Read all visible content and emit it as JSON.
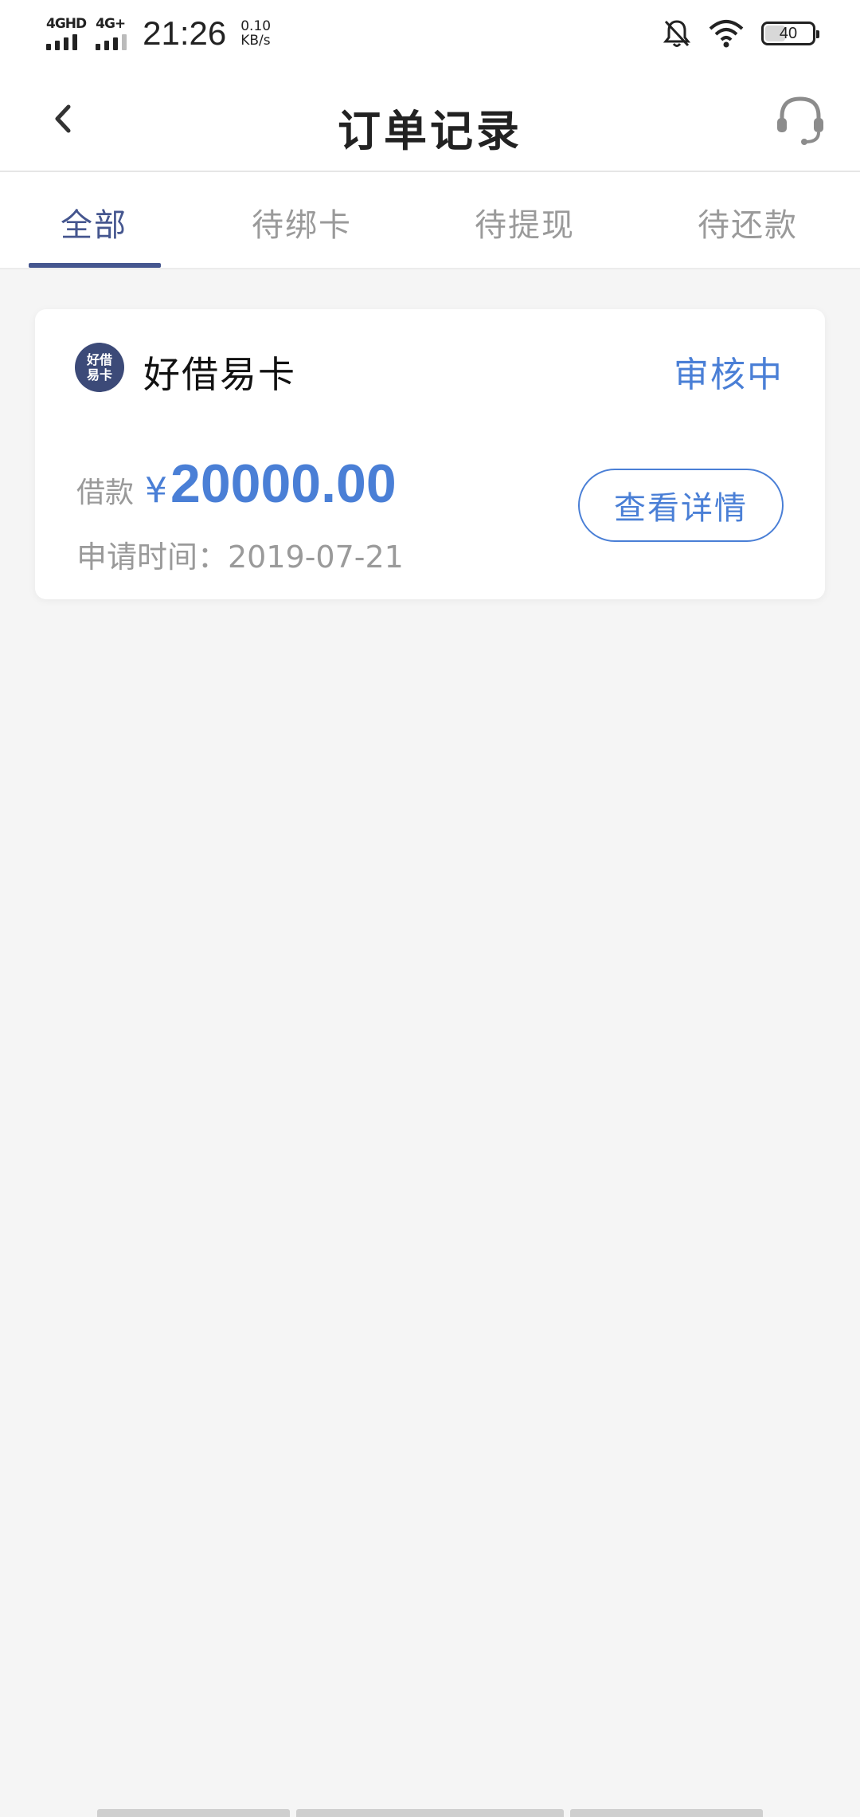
{
  "status_bar": {
    "network_1": "4GHD",
    "network_2": "4G+",
    "time": "21:26",
    "speed_value": "0.10",
    "speed_unit": "KB/s",
    "battery_level": "40",
    "icons": [
      "bell-off-icon",
      "wifi-icon",
      "battery-icon"
    ]
  },
  "header": {
    "title": "订单记录",
    "back_icon": "chevron-left-icon",
    "service_icon": "headset-icon"
  },
  "tabs": [
    {
      "label": "全部",
      "active": true
    },
    {
      "label": "待绑卡",
      "active": false
    },
    {
      "label": "待提现",
      "active": false
    },
    {
      "label": "待还款",
      "active": false
    }
  ],
  "order": {
    "logo_text_1": "好借",
    "logo_text_2": "易卡",
    "merchant": "好借易卡",
    "status": "审核中",
    "amount_label": "借款",
    "currency": "¥",
    "amount": "20000.00",
    "apply_time": "申请时间：2019-07-21",
    "detail_button": "查看详情"
  },
  "colors": {
    "accent": "#4a7fd6",
    "tab_active": "#45568f",
    "muted": "#9a9a9a",
    "background": "#f5f5f5"
  }
}
